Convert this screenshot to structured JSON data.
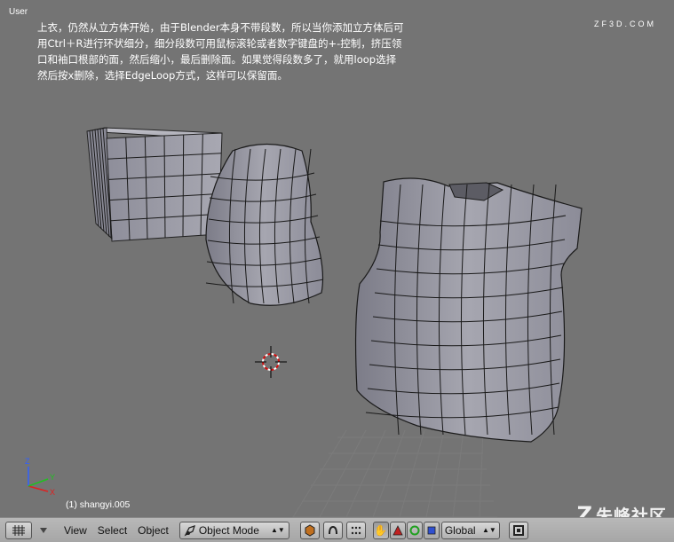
{
  "viewport": {
    "view_name": "User",
    "object_label": "(1) shangyi.005"
  },
  "tutorial": {
    "lines": [
      "上衣，仍然从立方体开始，由于Blender本身不带段数，所以当你添加立方体后可",
      "用Ctrl＋R进行环状细分，细分段数可用鼠标滚轮或者数字键盘的+-控制，挤压领",
      "口和袖口根部的面，然后缩小，最后删除面。如果觉得段数多了，就用loop选择",
      "然后按x删除，选择EdgeLoop方式，这样可以保留面。"
    ]
  },
  "axes": {
    "x": "X",
    "y": "Y",
    "z": "Z"
  },
  "watermark": {
    "text": "朱峰社区",
    "sub": "ZF3D.COM",
    "logo": "Z"
  },
  "header": {
    "menus": [
      "View",
      "Select",
      "Object"
    ],
    "mode": "Object Mode",
    "orientation": "Global"
  },
  "colors": {
    "viewport_bg": "#747474",
    "header_bg": "#b0b0b0",
    "mesh_face": "#9a9aa6",
    "mesh_edge": "#1a1a1a",
    "cursor_red": "#d01010"
  },
  "icons": [
    "grid-icon",
    "view-type-icon",
    "object-mode-icon",
    "shading-icon",
    "pivot-icon",
    "snap-icon",
    "hand-icon",
    "translate-icon",
    "rotate-icon",
    "scale-icon",
    "render-icon"
  ]
}
